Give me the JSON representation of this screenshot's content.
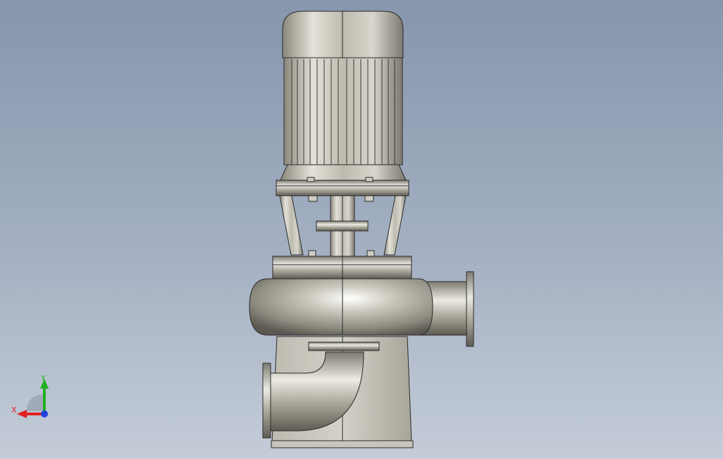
{
  "viewport": {
    "background_top": "#8696ad",
    "background_bottom": "#c4ccd8"
  },
  "model": {
    "name_icon": "vertical-centrifugal-pump-model",
    "metal_color": "#c8c4b4",
    "edge_color": "#2a2a2a"
  },
  "triad": {
    "x_label": "X",
    "y_label": "Y",
    "x_color": "#e02020",
    "y_color": "#20b020",
    "z_color": "#2040e0"
  }
}
